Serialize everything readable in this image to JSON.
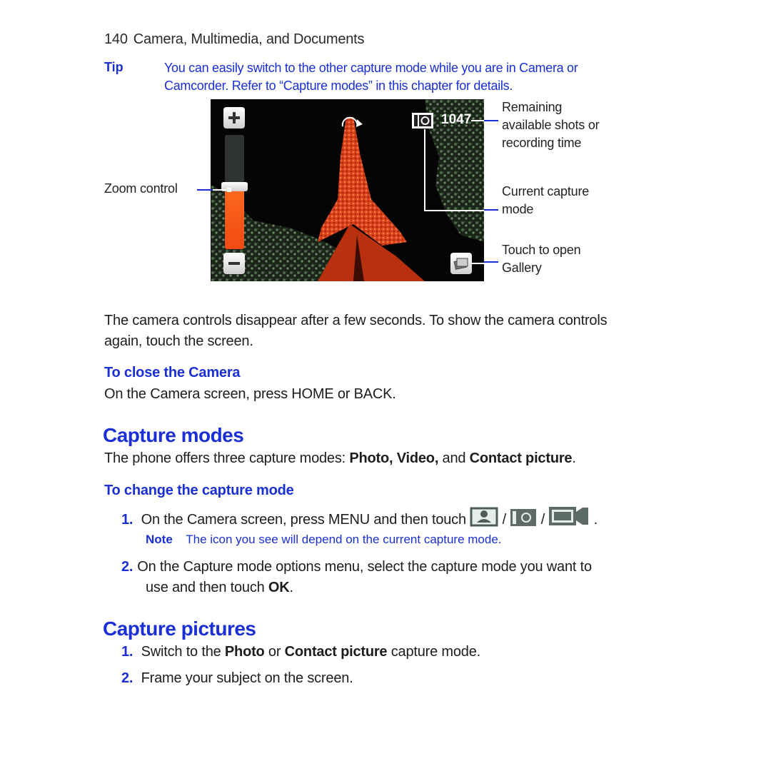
{
  "header": {
    "page_number": "140",
    "chapter_title": "Camera, Multimedia, and Documents"
  },
  "tip": {
    "label": "Tip",
    "line1": "You can easily switch to the other capture mode while you are in Camera or",
    "line2": "Camcorder. Refer to “Capture modes” in this chapter for details."
  },
  "figure": {
    "zoom_plus_icon": "plus-icon",
    "zoom_minus_icon": "minus-icon",
    "zoom_level": 0.55,
    "remaining_shots": "1047",
    "capture_mode_icon": "camera-icon",
    "gallery_icon": "gallery-icon",
    "callouts": {
      "zoom_control": "Zoom control",
      "remaining_line1": "Remaining",
      "remaining_line2": "available shots or",
      "remaining_line3": "recording time",
      "capture_line1": "Current capture",
      "capture_line2": "mode",
      "gallery_line1": "Touch to open",
      "gallery_line2": "Gallery"
    },
    "colors": {
      "zoom_fill": "#f04a14",
      "callout_line": "#1a2fd6"
    }
  },
  "intro": {
    "line1": "The camera controls disappear after a few seconds. To show the camera controls",
    "line2": "again, touch the screen."
  },
  "close_camera": {
    "heading": "To close the Camera",
    "text": "On the Camera screen, press HOME or BACK."
  },
  "capture_modes": {
    "heading": "Capture modes",
    "text_before": "The phone offers three capture modes: ",
    "mode1": "Photo, Video,",
    "text_and": " and ",
    "mode3": "Contact picture",
    "text_after": ".",
    "subheading": "To change the capture mode",
    "steps": [
      {
        "num": "1.",
        "text": "On the Camera screen, press MENU and then touch",
        "sep": "/",
        "end": "."
      },
      {
        "num": "2.",
        "line1": "On the Capture mode options menu, select the capture mode you want to",
        "line2_before": "use and then touch ",
        "line2_bold": "OK",
        "line2_after": "."
      }
    ],
    "icons": [
      "contact-picture-icon",
      "photo-camera-icon",
      "video-camera-icon"
    ],
    "note": {
      "label": "Note",
      "text": "The icon you see will depend on the current capture mode."
    }
  },
  "capture_pictures": {
    "heading": "Capture pictures",
    "steps": [
      {
        "num": "1.",
        "before": "Switch to the ",
        "bold1": "Photo",
        "mid": " or ",
        "bold2": "Contact picture",
        "after": " capture mode."
      },
      {
        "num": "2.",
        "text": "Frame your subject on the screen."
      }
    ]
  }
}
